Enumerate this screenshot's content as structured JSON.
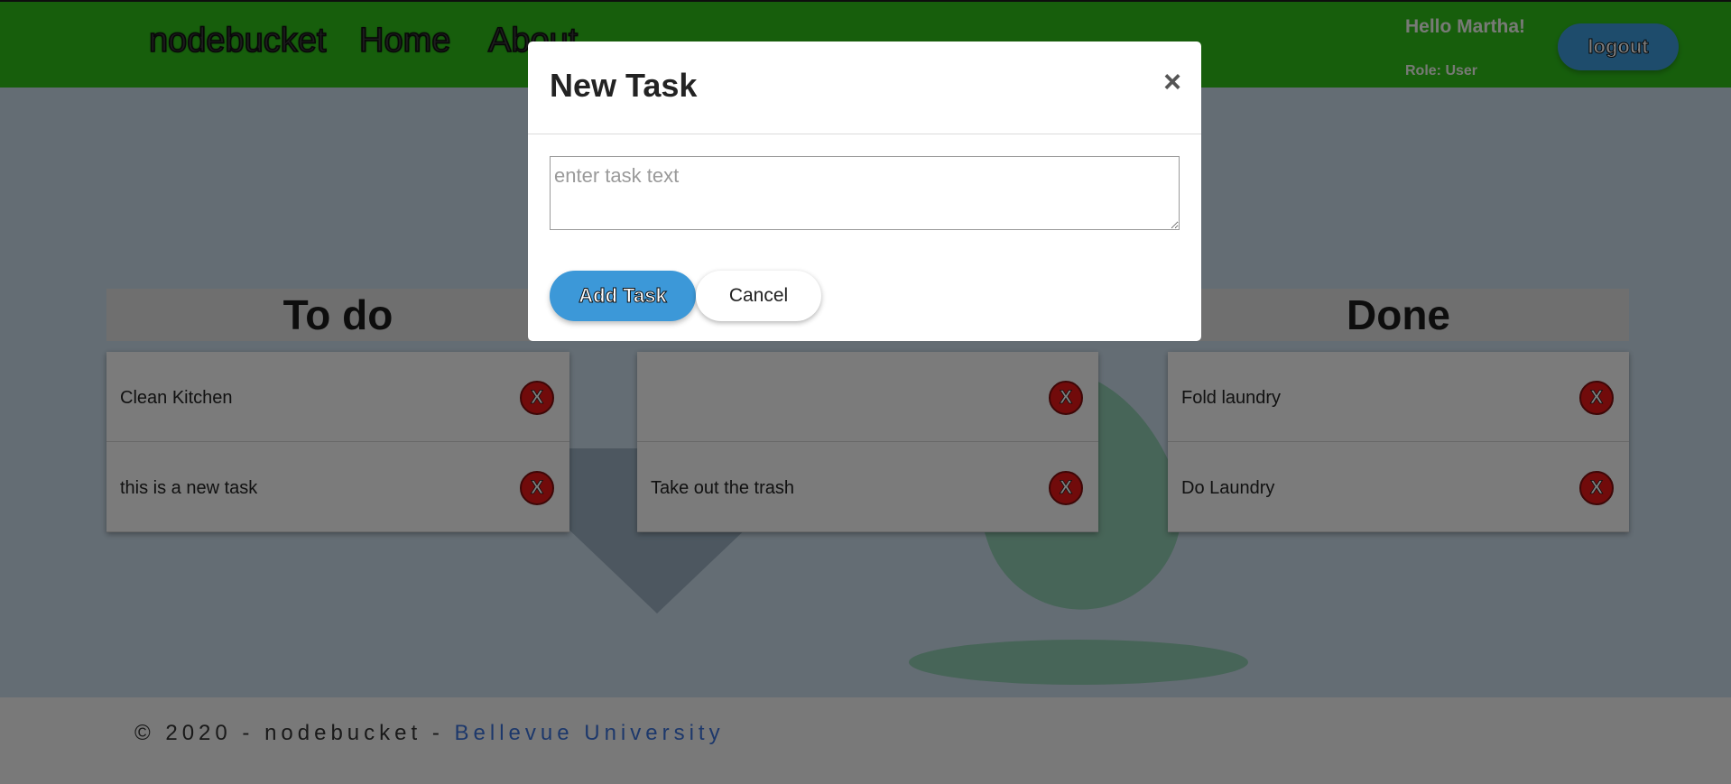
{
  "header": {
    "brand": "nodebucket",
    "nav": {
      "home": "Home",
      "about": "About"
    },
    "greeting": "Hello Martha!",
    "role": "Role: User",
    "logout_label": "logout"
  },
  "columns": {
    "todo": {
      "title": "To do",
      "tasks": [
        {
          "text": "Clean Kitchen",
          "delete_label": "X"
        },
        {
          "text": "this is a new task",
          "delete_label": "X"
        }
      ]
    },
    "doing": {
      "title": "",
      "tasks": [
        {
          "text": "",
          "delete_label": "X"
        },
        {
          "text": "Take out the trash",
          "delete_label": "X"
        }
      ]
    },
    "done": {
      "title": "Done",
      "tasks": [
        {
          "text": "Fold laundry",
          "delete_label": "X"
        },
        {
          "text": "Do Laundry",
          "delete_label": "X"
        }
      ]
    }
  },
  "footer": {
    "prefix": "© 2020 - nodebucket - ",
    "link": "Bellevue University"
  },
  "modal": {
    "title": "New Task",
    "close": "×",
    "input_placeholder": "enter task text",
    "add_label": "Add Task",
    "cancel_label": "Cancel"
  },
  "colors": {
    "header_bg": "#2ebd19",
    "accent_blue": "#3c98d8",
    "delete_red": "#e21616",
    "link_blue": "#3a70d6"
  }
}
